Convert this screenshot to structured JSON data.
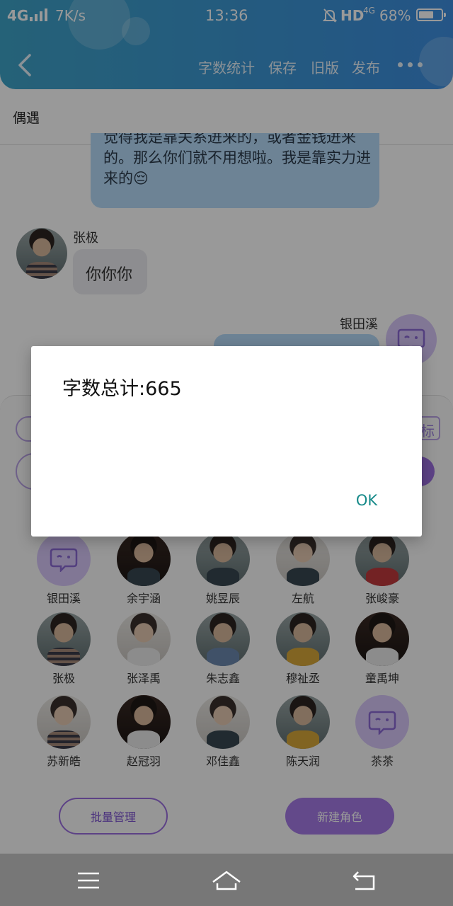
{
  "status_bar": {
    "network": "4G",
    "speed": "7K/s",
    "time": "13:36",
    "hd": "HD",
    "network_right": "4G",
    "battery": "68%",
    "battery_level": 0.68
  },
  "toolbar": {
    "items": [
      "字数统计",
      "保存",
      "旧版",
      "发布"
    ]
  },
  "page_title": "偶遇",
  "chat": {
    "message_right_1": "觉得我是靠关系进来的，或者金钱进来的。那么你们就不用想啦。我是靠实力进来的😔",
    "sender_left": "张极",
    "message_left": "你你你",
    "sender_right": "银田溪"
  },
  "panel": {
    "tag_label": "标"
  },
  "characters": [
    {
      "name": "银田溪",
      "avatar": "bot-icon"
    },
    {
      "name": "余宇涵",
      "avatar": "photo"
    },
    {
      "name": "姚昱辰",
      "avatar": "photo"
    },
    {
      "name": "左航",
      "avatar": "photo"
    },
    {
      "name": "张峻豪",
      "avatar": "photo"
    },
    {
      "name": "张极",
      "avatar": "photo"
    },
    {
      "name": "张泽禹",
      "avatar": "photo"
    },
    {
      "name": "朱志鑫",
      "avatar": "photo"
    },
    {
      "name": "穆祉丞",
      "avatar": "photo"
    },
    {
      "name": "童禹坤",
      "avatar": "photo"
    },
    {
      "name": "苏新皓",
      "avatar": "photo"
    },
    {
      "name": "赵冠羽",
      "avatar": "photo"
    },
    {
      "name": "邓佳鑫",
      "avatar": "photo"
    },
    {
      "name": "陈天润",
      "avatar": "photo"
    },
    {
      "name": "茶茶",
      "avatar": "bot-icon"
    }
  ],
  "buttons": {
    "batch_manage": "批量管理",
    "new_character": "新建角色"
  },
  "dialog": {
    "message": "字数总计:665",
    "ok": "OK"
  },
  "colors": {
    "header": "#3c97d4",
    "purple_accent": "#9b6fe0",
    "dialog_button": "#168a89"
  }
}
